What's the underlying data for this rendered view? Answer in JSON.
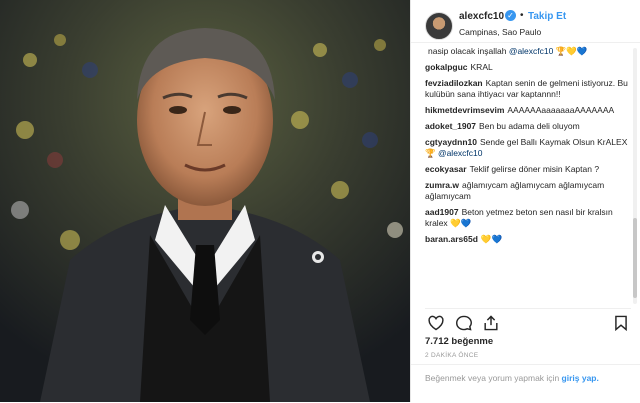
{
  "header": {
    "username": "alexcfc10",
    "follow_label": "Takip Et",
    "location": "Campinas, Sao Paulo"
  },
  "comments": [
    {
      "user": "",
      "text": "nasip olacak inşallah ",
      "mention": "@alexcfc10",
      "suffix": " 🏆💛💙"
    },
    {
      "user": "gokalpguc",
      "text": "KRAL",
      "mention": "",
      "suffix": ""
    },
    {
      "user": "fevziadilozkan",
      "text": "Kaptan senin de gelmeni istiyoruz. Bu kulübün sana ihtiyacı var kaptannn!!",
      "mention": "",
      "suffix": ""
    },
    {
      "user": "hikmetdevrimsevim",
      "text": "AAAAAAaaaaaaaAAAAAAA",
      "mention": "",
      "suffix": ""
    },
    {
      "user": "adoket_1907",
      "text": "Ben bu adama deli oluyom",
      "mention": "",
      "suffix": ""
    },
    {
      "user": "cgtyaydnn10",
      "text": "Sende gel Ballı Kaymak Olsun KrALEX 🏆 ",
      "mention": "@alexcfc10",
      "suffix": ""
    },
    {
      "user": "ecokyasar",
      "text": "Teklif gelirse döner misin Kaptan ?",
      "mention": "",
      "suffix": ""
    },
    {
      "user": "zumra.w",
      "text": "ağlamıycam ağlamıycam ağlamıycam ağlamıycam",
      "mention": "",
      "suffix": ""
    },
    {
      "user": "aad1907",
      "text": "Beton yetmez beton sen nasıl bir kralsın kralex 💛💙",
      "mention": "",
      "suffix": ""
    },
    {
      "user": "baran.ars65d",
      "text": "💛💙",
      "mention": "",
      "suffix": ""
    }
  ],
  "actions": {
    "like_icon": "heart-icon",
    "comment_icon": "comment-icon",
    "share_icon": "share-icon",
    "save_icon": "bookmark-icon"
  },
  "likes": "7.712 beğenme",
  "timestamp": "2 DAKİKA ÖNCE",
  "add_comment": {
    "text": "Beğenmek veya yorum yapmak için ",
    "login_label": "giriş yap."
  }
}
